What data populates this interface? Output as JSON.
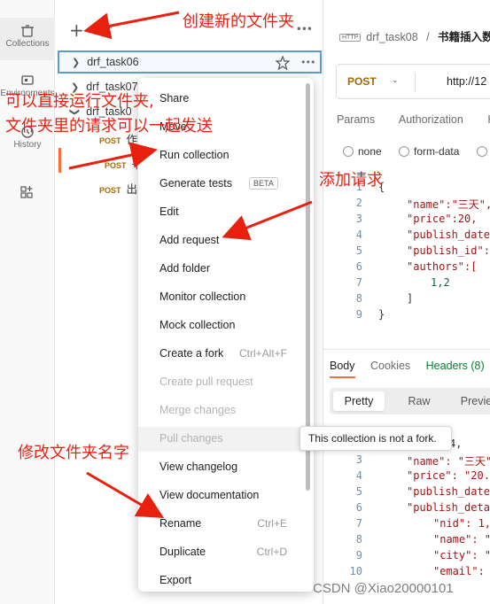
{
  "rail": {
    "items": [
      {
        "label": "Collections",
        "icon": "trash-can-icon"
      },
      {
        "label": "Environments",
        "icon": "environment-icon"
      },
      {
        "label": "History",
        "icon": "history-icon"
      },
      {
        "label": "",
        "icon": "apps-grid-icon"
      }
    ]
  },
  "sidebar": {
    "selected_folder": "drf_task06",
    "rows": [
      {
        "label": "drf_task07",
        "kind": "folder"
      },
      {
        "label": "drf_task0",
        "kind": "folder"
      },
      {
        "method": "POST",
        "label": "作"
      },
      {
        "method": "POST",
        "label": "书"
      },
      {
        "method": "POST",
        "label": "出"
      }
    ]
  },
  "context_menu": {
    "items": [
      {
        "label": "Share",
        "shortcut": "",
        "disabled": false
      },
      {
        "label": "Move",
        "shortcut": "",
        "disabled": false
      },
      {
        "label": "Run collection",
        "shortcut": "",
        "disabled": false
      },
      {
        "label": "Generate tests",
        "shortcut": "",
        "badge": "BETA",
        "disabled": false
      },
      {
        "label": "Edit",
        "shortcut": "",
        "disabled": false
      },
      {
        "label": "Add request",
        "shortcut": "",
        "disabled": false
      },
      {
        "label": "Add folder",
        "shortcut": "",
        "disabled": false
      },
      {
        "label": "Monitor collection",
        "shortcut": "",
        "disabled": false
      },
      {
        "label": "Mock collection",
        "shortcut": "",
        "disabled": false
      },
      {
        "label": "Create a fork",
        "shortcut": "Ctrl+Alt+F",
        "disabled": false
      },
      {
        "label": "Create pull request",
        "shortcut": "",
        "disabled": true
      },
      {
        "label": "Merge changes",
        "shortcut": "",
        "disabled": true
      },
      {
        "label": "Pull changes",
        "shortcut": "",
        "disabled": true
      },
      {
        "label": "View changelog",
        "shortcut": "",
        "disabled": false
      },
      {
        "label": "View documentation",
        "shortcut": "",
        "disabled": false
      },
      {
        "label": "Rename",
        "shortcut": "Ctrl+E",
        "disabled": false
      },
      {
        "label": "Duplicate",
        "shortcut": "Ctrl+D",
        "disabled": false
      },
      {
        "label": "Export",
        "shortcut": "",
        "disabled": false
      }
    ],
    "tooltip": "This collection is not a fork."
  },
  "request": {
    "breadcrumb_collection": "drf_task08",
    "breadcrumb_sep": "/",
    "breadcrumb_request": "书籍插入数",
    "http_badge": "HTTP",
    "method": "POST",
    "url": "http://12",
    "tabs": [
      "Params",
      "Authorization",
      "H"
    ],
    "body_types": [
      "none",
      "form-data",
      ""
    ]
  },
  "request_body": {
    "lines": [
      {
        "n": "1",
        "text": "{"
      },
      {
        "n": "2",
        "text": "\"name\":\"三天\","
      },
      {
        "n": "3",
        "text": "\"price\":20,"
      },
      {
        "n": "4",
        "text": "\"publish_date"
      },
      {
        "n": "5",
        "text": "\"publish_id\":"
      },
      {
        "n": "6",
        "text": "\"authors\":["
      },
      {
        "n": "7",
        "text": "1,2"
      },
      {
        "n": "8",
        "text": "]"
      },
      {
        "n": "9",
        "text": "}"
      }
    ]
  },
  "response": {
    "tabs": [
      "Body",
      "Cookies",
      "Headers (8)"
    ],
    "views": [
      "Pretty",
      "Raw",
      "Preview"
    ],
    "lines": [
      {
        "n": "",
        "text": "4,"
      },
      {
        "n": "3",
        "text": "\"name\": \"三天\""
      },
      {
        "n": "4",
        "text": "\"price\": \"20.0"
      },
      {
        "n": "5",
        "text": "\"publish_date\""
      },
      {
        "n": "6",
        "text": "\"publish_detai"
      },
      {
        "n": "7",
        "text": "\"nid\": 1,"
      },
      {
        "n": "8",
        "text": "\"name\": \""
      },
      {
        "n": "9",
        "text": "\"city\": \""
      },
      {
        "n": "10",
        "text": "\"email\": \""
      },
      {
        "n": "11",
        "text": ""
      }
    ]
  },
  "annotations": {
    "new_folder": "创建新的文件夹",
    "run_folder_line1": "可以直接运行文件夹,",
    "run_folder_line2": "文件夹里的请求可以一起发送",
    "add_request": "添加请求",
    "rename_folder": "修改文件夹名字"
  },
  "watermark": "CSDN @Xiao20000101",
  "colors": {
    "annotation": "#e8210f",
    "post": "#a66a00",
    "accent": "#ff6c37",
    "selected_border": "#5b9bd5"
  }
}
